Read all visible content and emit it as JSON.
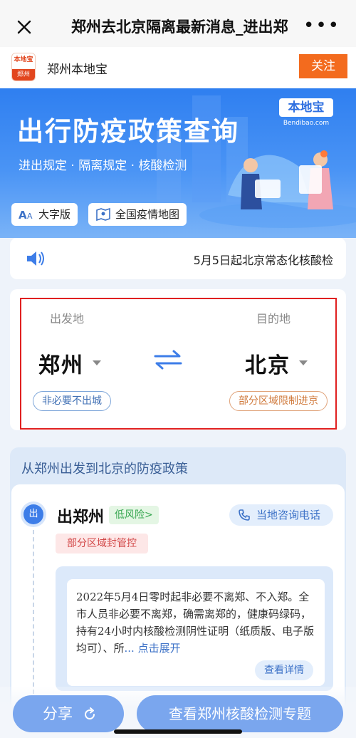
{
  "nav": {
    "title": "郑州去北京隔离最新消息_进出郑",
    "more": "•••"
  },
  "account": {
    "logo_top": "本地宝",
    "logo_bottom": "郑州",
    "name": "郑州本地宝",
    "follow_label": "关注"
  },
  "banner": {
    "title": "出行防疫政策查询",
    "subtitle": "进出规定 · 隔离规定 · 核酸检测",
    "brand_name": "本地宝",
    "brand_url": "Bendibao.com",
    "large_font_label": "大字版",
    "map_label": "全国疫情地图"
  },
  "notice": {
    "text": "5月5日起北京常态化核酸检"
  },
  "travel": {
    "origin_label": "出发地",
    "origin_city": "郑州",
    "origin_tag": "非必要不出城",
    "dest_label": "目的地",
    "dest_city": "北京",
    "dest_tag": "部分区域限制进京"
  },
  "policy": {
    "section_title": "从郑州出发到北京的防疫政策",
    "out_badge": "出",
    "out_title": "出郑州",
    "risk_label": "低风险>",
    "phone_label": "当地咨询电话",
    "status_tag": "部分区域封管控",
    "detail_text": "2022年5月4日零时起非必要不离郑、不入郑。全市人员非必要不离郑，确需离郑的，健康码绿码，持有24小时内核酸检测阴性证明（纸质版、电子版均可）、所",
    "expand_label": "... 点击展开",
    "view_label": "查看详情"
  },
  "bottom": {
    "share_label": "分享",
    "topic_label": "查看郑州核酸检测专题"
  },
  "colors": {
    "accent": "#3d7de8",
    "follow": "#f36b1e",
    "highlight_frame": "#e02020"
  }
}
